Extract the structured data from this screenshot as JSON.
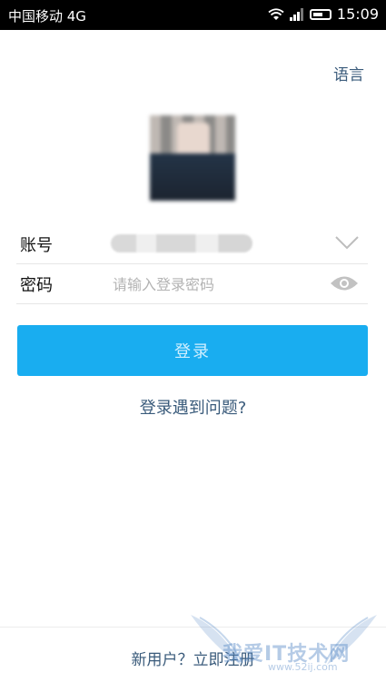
{
  "status_bar": {
    "carrier": "中国移动 4G",
    "time": "15:09"
  },
  "header": {
    "language_label": "语言"
  },
  "form": {
    "account_label": "账号",
    "password_label": "密码",
    "password_placeholder": "请输入登录密码"
  },
  "actions": {
    "login_label": "登录",
    "problem_label": "登录遇到问题?",
    "register_label": "新用户？立即注册"
  },
  "watermark": {
    "title": "我爱IT技术网",
    "url": "www.52ij.com"
  },
  "colors": {
    "accent": "#19adf0",
    "link": "#3a5b7b"
  }
}
